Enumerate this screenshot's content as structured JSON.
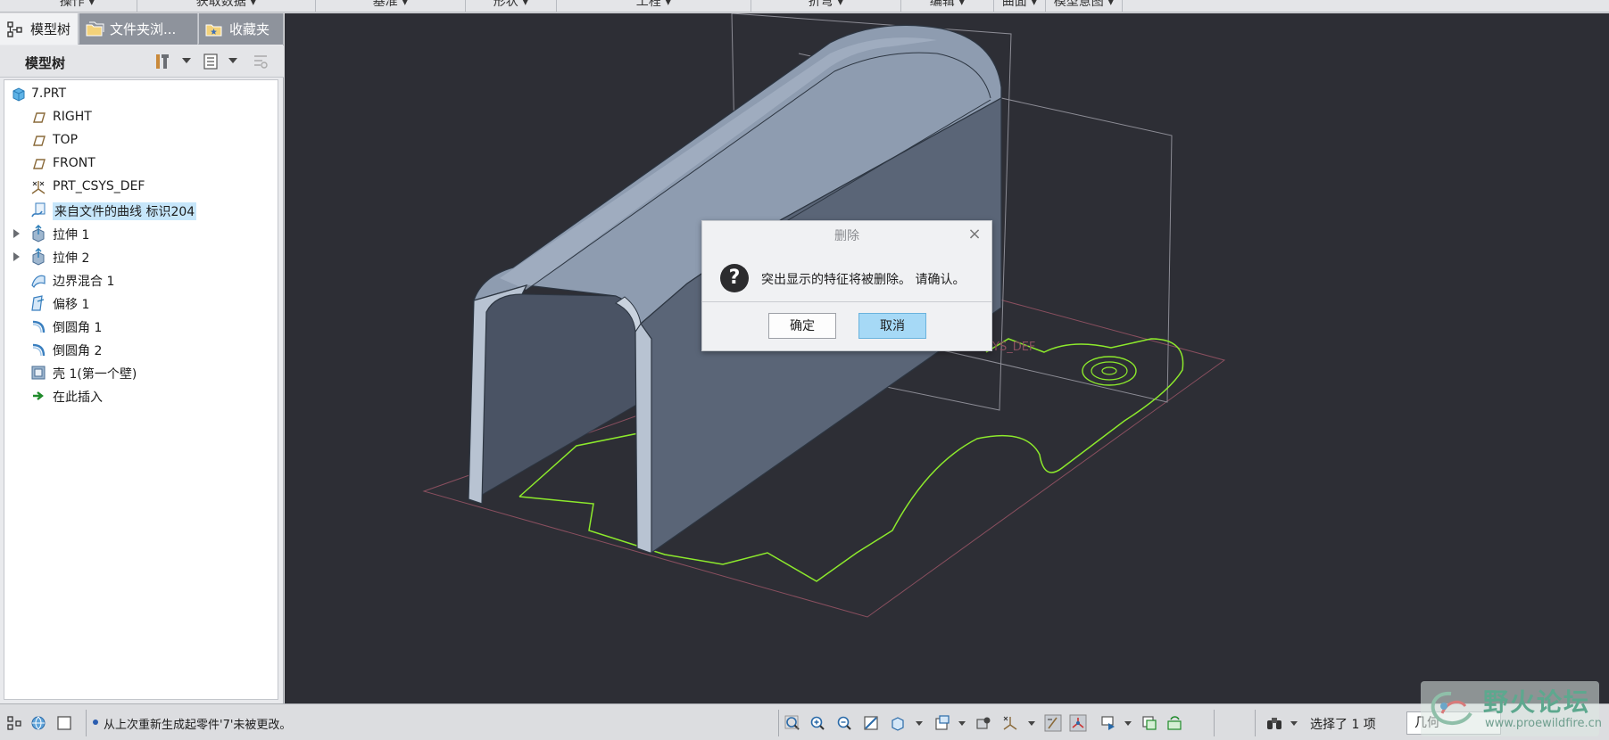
{
  "menu": {
    "items": [
      "操作",
      "获取数据",
      "基准",
      "形状",
      "工程",
      "折弯",
      "编辑",
      "曲面",
      "模型意图"
    ]
  },
  "tabs": {
    "model_tree": "模型树",
    "folder_browser": "文件夹浏...",
    "favorites": "收藏夹"
  },
  "tree": {
    "title": "模型树",
    "items": [
      {
        "label": "7.PRT",
        "icon": "part-icon"
      },
      {
        "label": "RIGHT",
        "icon": "datum-plane-icon"
      },
      {
        "label": "TOP",
        "icon": "datum-plane-icon"
      },
      {
        "label": "FRONT",
        "icon": "datum-plane-icon"
      },
      {
        "label": "PRT_CSYS_DEF",
        "icon": "csys-icon"
      },
      {
        "label": "来自文件的曲线 标识204",
        "icon": "curve-from-file-icon"
      },
      {
        "label": "拉伸 1",
        "icon": "extrude-icon"
      },
      {
        "label": "拉伸 2",
        "icon": "extrude-icon"
      },
      {
        "label": "边界混合 1",
        "icon": "boundary-blend-icon"
      },
      {
        "label": "偏移 1",
        "icon": "offset-icon"
      },
      {
        "label": "倒圆角 1",
        "icon": "round-icon"
      },
      {
        "label": "倒圆角 2",
        "icon": "round-icon"
      },
      {
        "label": "壳 1(第一个壁)",
        "icon": "shell-icon"
      },
      {
        "label": "在此插入",
        "icon": "insert-here-icon"
      }
    ]
  },
  "viewport": {
    "csys_label": "YS_DEF"
  },
  "dialog": {
    "title": "删除",
    "close": "×",
    "icon": "?",
    "message": "突出显示的特征将被删除。 请确认。",
    "ok_label": "确定",
    "cancel_label": "取消"
  },
  "status": {
    "message": "从上次重新生成起零件'7'未被更改。",
    "selection": "选择了 1 项",
    "filter": "几何"
  },
  "watermark": {
    "title": "野火论坛",
    "url": "www.proewildfire.cn"
  },
  "colors": {
    "viewport_bg": "#2d2e35",
    "curve": "#8dea2c",
    "selection_bg": "#c6e6fa",
    "primary_button": "#a6d9f6"
  }
}
